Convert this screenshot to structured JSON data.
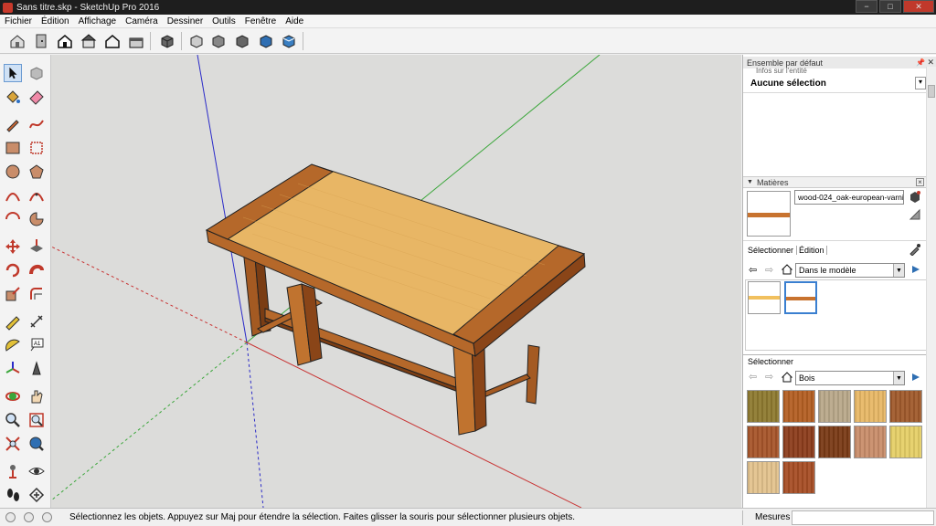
{
  "window": {
    "title": "Sans titre.skp - SketchUp Pro 2016"
  },
  "menu": [
    "Fichier",
    "Édition",
    "Affichage",
    "Caméra",
    "Dessiner",
    "Outils",
    "Fenêtre",
    "Aide"
  ],
  "tray": {
    "title": "Ensemble par défaut",
    "entity_info_title": "Infos sur l'entité",
    "selection_text": "Aucune sélection",
    "materials_title": "Matières",
    "material_name": "wood-024_oak-european-varnisl",
    "tabs": [
      "Sélectionner",
      "Édition"
    ],
    "collection_in_model": "Dans le modèle",
    "secondary_section_label": "Sélectionner",
    "collection_library": "Bois",
    "model_materials": [
      {
        "colors": [
          "#ffffff",
          "#f1c05e"
        ]
      },
      {
        "colors": [
          "#ffffff",
          "#c8732f"
        ]
      }
    ],
    "library_swatches": [
      {
        "color": "#8e7a30"
      },
      {
        "color": "#b45f23"
      },
      {
        "color": "#b9a88a"
      },
      {
        "color": "#e8b866"
      },
      {
        "color": "#a05a2c"
      },
      {
        "color": "#a7552a"
      },
      {
        "color": "#8c3d1c"
      },
      {
        "color": "#7a3a16"
      },
      {
        "color": "#c98d6a"
      },
      {
        "color": "#e6cf67"
      },
      {
        "color": "#e3c28d"
      },
      {
        "color": "#a74e25"
      }
    ]
  },
  "status": {
    "hint": "Sélectionnez les objets. Appuyez sur Maj pour étendre la sélection. Faites glisser la souris pour sélectionner plusieurs objets.",
    "measure_label": "Mesures",
    "measure_value": ""
  },
  "colors": {
    "wood_light": "#e8b665",
    "wood_dark": "#b5682a",
    "axis_red": "#c83232",
    "axis_green": "#3aa63a",
    "axis_blue": "#2a2ac8"
  },
  "icons": {
    "toolbar": [
      "house-icon",
      "door-icon",
      "house-front-icon",
      "house-roof-icon",
      "house-outline-icon",
      "house-side-icon",
      "box-iso-icon",
      "box-x-ray-icon",
      "box-wireframe-icon",
      "box-hidden-icon",
      "box-shaded-icon",
      "box-textured-icon",
      "box-mono-icon"
    ],
    "left_tools": [
      "select-icon",
      "component-icon",
      "paint-bucket-icon",
      "eraser-icon",
      "pencil-icon",
      "freehand-icon",
      "rectangle-icon",
      "rotated-rectangle-icon",
      "circle-icon",
      "polygon-icon",
      "arc-icon",
      "arc-2-icon",
      "arc-3-icon",
      "pie-icon",
      "move-icon",
      "push-pull-icon",
      "rotate-icon",
      "follow-me-icon",
      "scale-icon",
      "offset-icon",
      "tape-measure-icon",
      "dimension-icon",
      "protractor-icon",
      "text-icon",
      "axes-icon",
      "3d-text-icon",
      "orbit-icon",
      "pan-icon",
      "zoom-icon",
      "zoom-window-icon",
      "zoom-extents-icon",
      "previous-view-icon",
      "position-camera-icon",
      "look-around-icon",
      "walk-icon",
      "section-plane-icon"
    ]
  }
}
